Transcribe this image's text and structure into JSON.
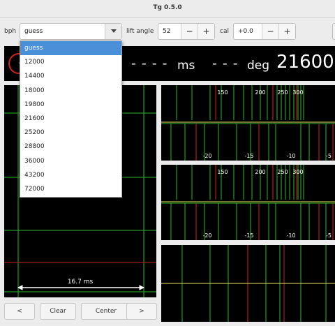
{
  "window": {
    "title": "Tg 0.5.0"
  },
  "toolbar": {
    "bph_label": "bph",
    "bph_value": "guess",
    "lift_label": "lift angle",
    "lift_value": "52",
    "cal_label": "cal",
    "cal_value": "+0.0",
    "minus": "−",
    "plus": "+"
  },
  "status": {
    "rate": "- - - -",
    "rate_unit": "ms",
    "amplitude": "- - -",
    "amplitude_unit": "deg",
    "bph_display": "21600"
  },
  "bph_dropdown": {
    "selected": "guess",
    "options": [
      "guess",
      "12000",
      "14400",
      "18000",
      "19800",
      "21600",
      "25200",
      "28800",
      "36000",
      "43200",
      "72000"
    ]
  },
  "waveform": {
    "top_scale": [
      "150",
      "200",
      "250",
      "300"
    ],
    "bottom_scale": [
      "-20",
      "-15",
      "-10",
      "-5"
    ]
  },
  "paperstrip": {
    "span": "16.7 ms"
  },
  "buttons": {
    "prev": "<",
    "clear": "Clear",
    "center": "Center",
    "next": ">"
  },
  "colors": {
    "grid": "#2db92d",
    "marker": "#d22020",
    "trace": "#e8e85a",
    "background": "#000000",
    "selection": "#4a90d9"
  }
}
